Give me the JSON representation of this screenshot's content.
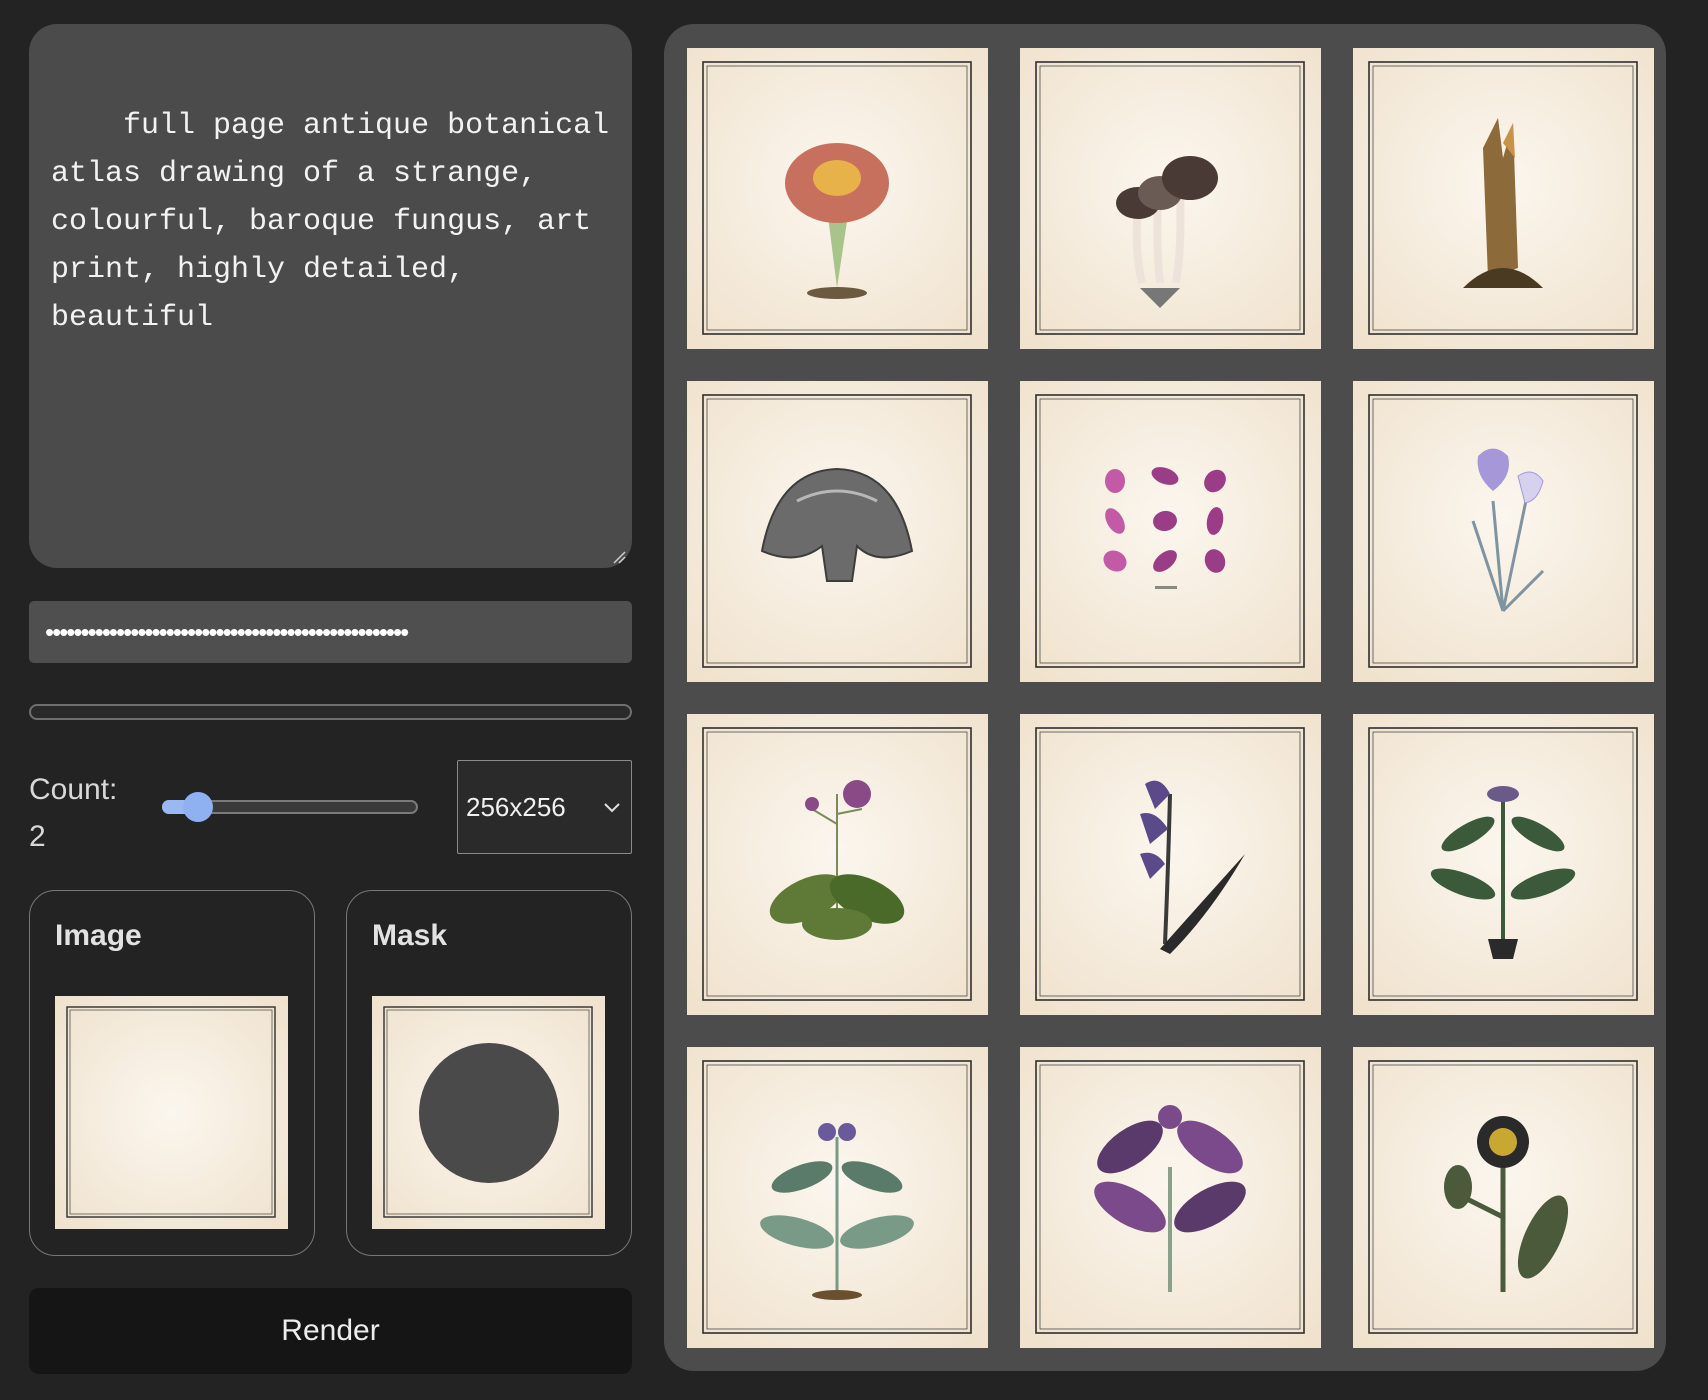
{
  "prompt": {
    "text": "full page antique botanical atlas drawing of a strange, colourful, baroque fungus, art print, highly detailed, beautiful"
  },
  "api_key": {
    "masked_value": "•••••••••••••••••••••••••••••••••••••••••••••••••••"
  },
  "progress": {
    "value": 0
  },
  "count": {
    "label": "Count:",
    "value": "2",
    "slider_fraction": 0.14
  },
  "size_select": {
    "selected": "256x256"
  },
  "image_card": {
    "title": "Image"
  },
  "mask_card": {
    "title": "Mask"
  },
  "render_button": {
    "label": "Render"
  },
  "gallery": {
    "items": [
      {
        "subject": "coral-fungus-illustration",
        "colors": [
          "#c7705e",
          "#e7b24a",
          "#a9c48a"
        ]
      },
      {
        "subject": "mushroom-cluster-illustration",
        "colors": [
          "#4a3a36",
          "#eee3da",
          "#6b5b55"
        ]
      },
      {
        "subject": "root-specimen-illustration",
        "colors": [
          "#8c6a3a",
          "#c9924a",
          "#4a3a22"
        ]
      },
      {
        "subject": "gray-mushroom-cap-illustration",
        "colors": [
          "#6b6b6b",
          "#b8b8b8",
          "#3d3d3d"
        ]
      },
      {
        "subject": "purple-seeds-illustration",
        "colors": [
          "#9a3c86",
          "#c25aa5",
          "#6b2a5e"
        ]
      },
      {
        "subject": "iris-flower-illustration",
        "colors": [
          "#a597d8",
          "#7f93a0",
          "#d7d1f0"
        ]
      },
      {
        "subject": "violet-primrose-illustration",
        "colors": [
          "#5f7a36",
          "#8a4a86",
          "#4a6a2a"
        ]
      },
      {
        "subject": "bluebell-illustration",
        "colors": [
          "#5a4a8a",
          "#3a3a3a",
          "#2a2a2a"
        ]
      },
      {
        "subject": "potted-plant-illustration",
        "colors": [
          "#3a5a3a",
          "#6a5a8a",
          "#2a2a2a"
        ]
      },
      {
        "subject": "blue-flower-plant-illustration",
        "colors": [
          "#5a7a6a",
          "#6a5a9a",
          "#7a9a88"
        ]
      },
      {
        "subject": "purple-leaf-plant-illustration",
        "colors": [
          "#5a3a6a",
          "#7a4a8a",
          "#8aa08a"
        ]
      },
      {
        "subject": "yellow-thistle-illustration",
        "colors": [
          "#c9a832",
          "#4a5a3a",
          "#2a2a2a"
        ]
      }
    ]
  }
}
